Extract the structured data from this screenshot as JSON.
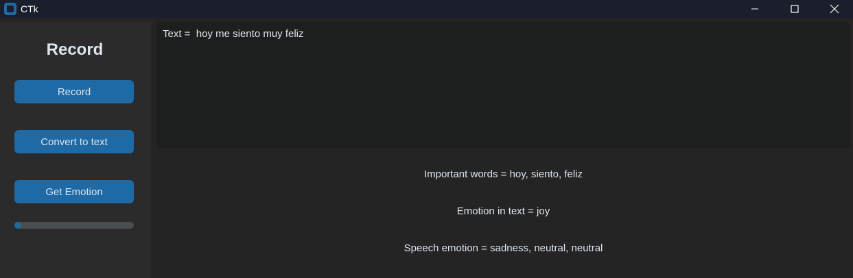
{
  "window": {
    "title": "CTk",
    "icon": "ctk-app-icon",
    "controls": [
      "minimize-icon",
      "maximize-icon",
      "close-icon"
    ]
  },
  "sidebar": {
    "title": "Record",
    "buttons": [
      {
        "label": "Record"
      },
      {
        "label": "Convert to text"
      },
      {
        "label": "Get Emotion"
      }
    ],
    "progress": {
      "value": 0.06
    }
  },
  "main": {
    "text_box": "Text =  hoy me siento muy feliz",
    "important_words": "Important words = hoy, siento, feliz",
    "emotion_in_text": "Emotion in text = joy",
    "speech_emotion": "Speech emotion = sadness, neutral, neutral"
  },
  "colors": {
    "accent": "#1f6aa5",
    "titlebar": "#1b1e2c",
    "sidebar": "#2b2b2b",
    "background": "#242424",
    "textbox": "#1d1e1e",
    "text": "#dce4ee"
  }
}
